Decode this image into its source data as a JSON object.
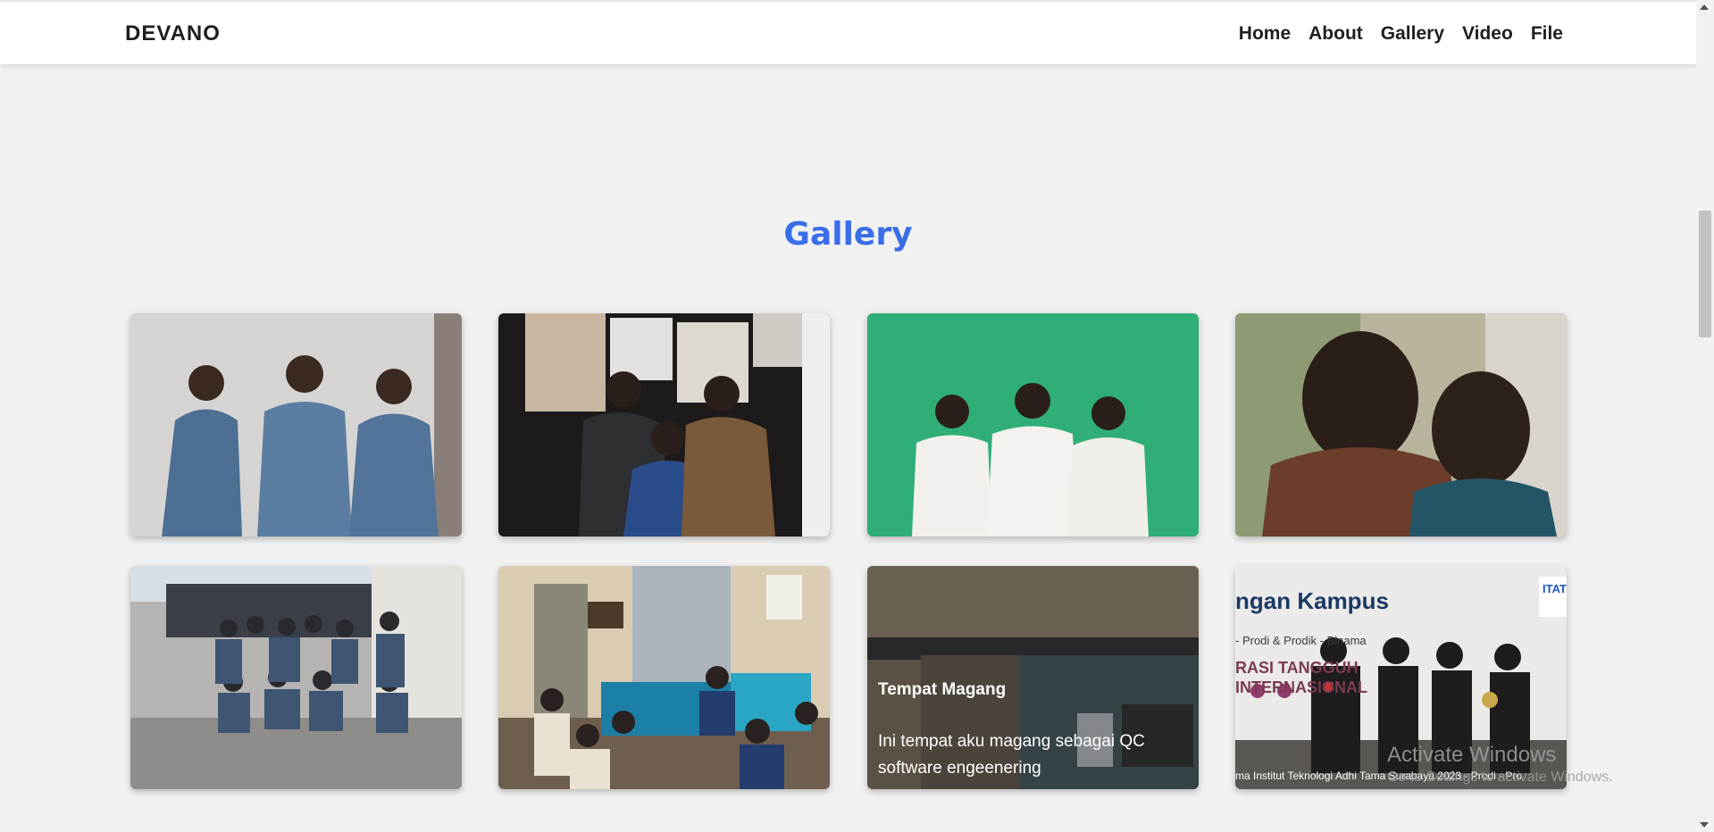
{
  "navbar": {
    "brand": "DEVANO",
    "links": [
      "Home",
      "About",
      "Gallery",
      "Video",
      "File"
    ]
  },
  "gallery": {
    "title": "Gallery",
    "title_color": "#3a6ee8",
    "items": [
      {
        "photo": "three students in blue jackets posing"
      },
      {
        "photo": "three students in masks posing at notice board"
      },
      {
        "photo": "three students in white uniforms on green background"
      },
      {
        "photo": "two students close-up looking at laptop"
      },
      {
        "photo": "group of students in alley"
      },
      {
        "photo": "group meeting on blue sofas in office"
      },
      {
        "photo": "internship office",
        "overlay_title": "Tempat Magang",
        "overlay_desc": "Ini tempat aku magang sebagai QC software engeenering"
      },
      {
        "photo": "award ceremony on stage",
        "banner_text": "ngan Kampus",
        "banner_sub": "- Prodi & Prodik - Binama",
        "banner_line": "RASI TANGGUH",
        "banner_line2": "INTERNASIONAL",
        "logo": "ITAT",
        "caption": "ma Institut Teknologi Adhi Tama Surabaya 2023 -  Prodi - Pro"
      }
    ]
  },
  "watermark": {
    "line1": "Activate Windows",
    "line2": "Go to Settings to activate Windows."
  }
}
